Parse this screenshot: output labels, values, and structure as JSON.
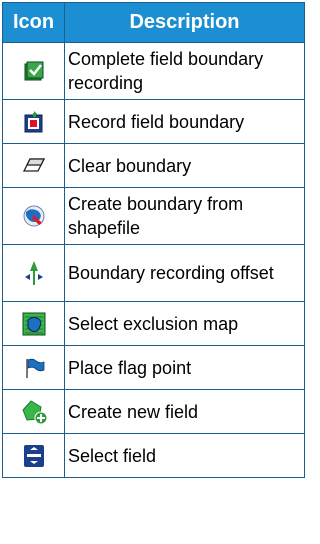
{
  "table": {
    "header": {
      "icon": "Icon",
      "description": "Description"
    },
    "header_color": "#1b8fd1",
    "border_color": "#1b5f8e",
    "rows": [
      {
        "icon": "complete-boundary-icon",
        "description": "Complete field boundary recording"
      },
      {
        "icon": "record-boundary-icon",
        "description": "Record field boundary"
      },
      {
        "icon": "eraser-icon",
        "description": "Clear boundary"
      },
      {
        "icon": "shapefile-boundary-icon",
        "description": "Create boundary from shapefile"
      },
      {
        "icon": "boundary-offset-icon",
        "description": "Boundary recording offset"
      },
      {
        "icon": "exclusion-map-icon",
        "description": "Select exclusion map"
      },
      {
        "icon": "flag-icon",
        "description": "Place flag point"
      },
      {
        "icon": "new-field-icon",
        "description": "Create new field"
      },
      {
        "icon": "select-field-icon",
        "description": "Select field"
      }
    ]
  }
}
